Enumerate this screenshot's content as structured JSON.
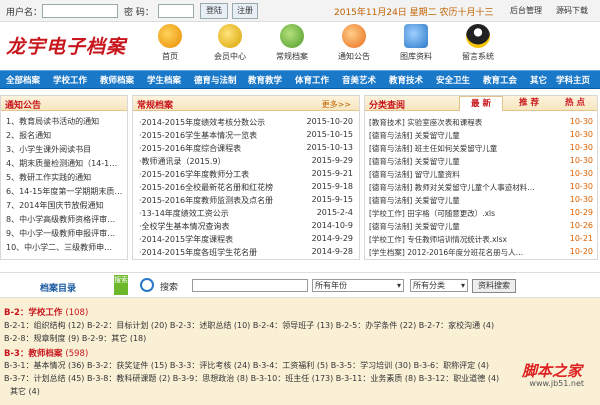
{
  "topbar": {
    "username_label": "用户名：",
    "password_label": "密 码：",
    "login_btn": "登陆",
    "register_btn": "注册",
    "date_text": "2015年11月24日 星期二 农历十月十三",
    "admin_link": "后台管理",
    "source_link": "源码下载"
  },
  "logo": "龙宇电子档案",
  "nav": [
    {
      "label": "首页",
      "icon": "home-icon"
    },
    {
      "label": "会员中心",
      "icon": "member-bag-icon"
    },
    {
      "label": "常规档案",
      "icon": "folder-icon"
    },
    {
      "label": "通知公告",
      "icon": "notice-icon"
    },
    {
      "label": "图库资料",
      "icon": "gallery-icon"
    },
    {
      "label": "留言系统",
      "icon": "qq-penguin-icon"
    }
  ],
  "menu": [
    "全部档案",
    "学校工作",
    "教师档案",
    "学生档案",
    "德育与法制",
    "教育教学",
    "体育工作",
    "音美艺术",
    "教育技术",
    "安全卫生",
    "教育工会",
    "其它",
    "学科主页"
  ],
  "notice": {
    "title": "通知公告",
    "items": [
      "1、教育局读书活动的通知",
      "2、报名通知",
      "3、小学生课外阅读书目",
      "4、期末质量检测通知（14-1…",
      "5、教研工作实践的通知",
      "6、14-15年度第一学期期末质…",
      "7、2014年国庆节放假通知",
      "8、中小学高级教师资格评审…",
      "9、中小学一级教师申报评审…",
      "10、中小学二、三级教师申…"
    ]
  },
  "archives": {
    "title": "常规档案",
    "more": "更多>>",
    "items": [
      {
        "t": "·2014-2015年度绩效考核分数公示",
        "d": "2015-10-20"
      },
      {
        "t": "·2015-2016学生基本情况一览表",
        "d": "2015-10-15"
      },
      {
        "t": "·2015-2016年度综合课程表",
        "d": "2015-10-13"
      },
      {
        "t": "·教师通讯录（2015.9）",
        "d": "2015-9-29"
      },
      {
        "t": "·2015-2016学年度教师分工表",
        "d": "2015-9-21"
      },
      {
        "t": "·2015-2016全校最新花名册和红花榜",
        "d": "2015-9-18"
      },
      {
        "t": "·2015-2016年度教师监测表及点名册",
        "d": "2015-9-15"
      },
      {
        "t": "·13-14年度绩效工资公示",
        "d": "2015-2-4"
      },
      {
        "t": "·全校学生基本情况查询表",
        "d": "2014-10-9"
      },
      {
        "t": "·2014-2015学年度课程表",
        "d": "2014-9-29"
      },
      {
        "t": "·2014-2015年度各班学生花名册",
        "d": "2014-9-28"
      }
    ]
  },
  "category": {
    "title": "分类查阅",
    "tabs": [
      "最 新",
      "推 荐",
      "热 点"
    ],
    "items": [
      {
        "t": "[教育技术] 实验室座次表和课程表",
        "d": "10-30"
      },
      {
        "t": "[德育与法制] 关爱留守儿童",
        "d": "10-30"
      },
      {
        "t": "[德育与法制] 班主任如何关爱留守儿童",
        "d": "10-30"
      },
      {
        "t": "[德育与法制] 关爱留守儿童",
        "d": "10-30"
      },
      {
        "t": "[德育与法制] 留守儿童资料",
        "d": "10-30"
      },
      {
        "t": "[德育与法制] 教师对关爱留守儿童个人事迹材料…",
        "d": "10-30"
      },
      {
        "t": "[德育与法制] 关爱留守儿童",
        "d": "10-30"
      },
      {
        "t": "[学校工作] 田字格（可随意更改）.xls",
        "d": "10-29"
      },
      {
        "t": "[德育与法制] 关爱留守儿童",
        "d": "10-26"
      },
      {
        "t": "[学校工作] 专任教师培训情况统计表.xlsx",
        "d": "10-21"
      },
      {
        "t": "[学生档案] 2012-2016年度分班花名册与人…",
        "d": "10-20"
      }
    ]
  },
  "search": {
    "dir_label": "档案目录",
    "side_tag": "搜索",
    "label": "搜索",
    "year_select": "所有年份",
    "cat_select": "所有分类",
    "btn": "资料搜索"
  },
  "directory": {
    "sections": [
      {
        "code": "B-2：",
        "name": "学校工作",
        "count": "(108)"
      },
      {
        "code": "B-3：",
        "name": "教师档案",
        "count": "(598)"
      }
    ],
    "rows": [
      "B-2-1：组织结构 (12)  B-2-2：目标计划 (20)  B-2-3：述职总结 (10)  B-2-4：领导班子 (13)  B-2-5：办学条件 (22)  B-2-7：家校沟通 (4)",
      "B-2-8：规章制度 (9)  B-2-9：其它 (18)",
      "B-3-1：基本情况 (36)  B-3-2：获奖证件 (15)  B-3-3：评比考核 (24)  B-3-4：工资福利 (5)  B-3-5：学习培训 (30)  B-3-6：职称评定 (4)",
      "B-3-7：计划总结 (45)  B-3-8：教科研课题 (2)  B-3-9：思想政治 (8)  B-3-10：班主任 (173)  B-3-11：业务素质 (8)  B-3-12：职业道德 (4)",
      "其它 (4)"
    ]
  },
  "watermark": {
    "brand": "脚本之家",
    "url": "www.jb51.net"
  },
  "colors": {
    "accent_red": "#c8161d",
    "menu_blue": "#1a78c8",
    "date_orange": "#c06000",
    "dir_bg": "#f9f0d6"
  }
}
